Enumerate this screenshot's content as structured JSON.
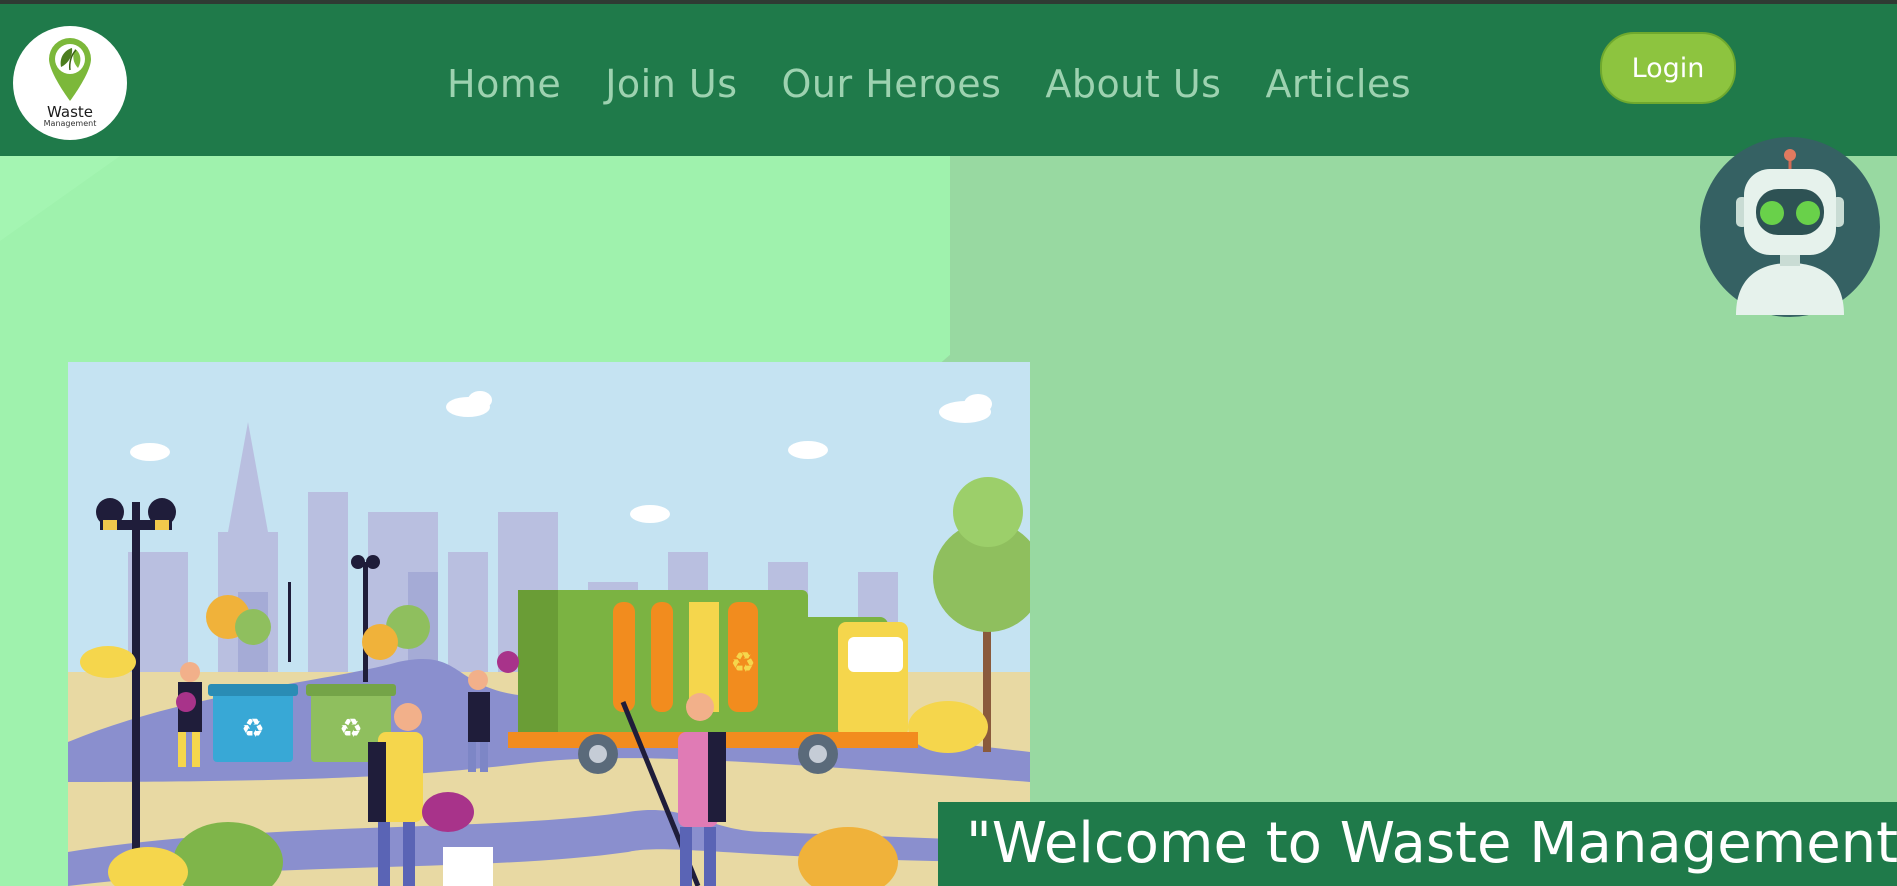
{
  "brand": {
    "logo_text": "Waste",
    "logo_sub": "Management",
    "colors": {
      "navbar": "#1f7a4a",
      "nav_link": "#9dd2b0",
      "login_bg": "#8dc43f",
      "hero_bg": "#98d9a1",
      "chatbot_bg": "#356163"
    }
  },
  "nav": {
    "links": [
      "Home",
      "Join Us",
      "Our Heroes",
      "About Us",
      "Articles"
    ],
    "login_label": "Login"
  },
  "chatbot": {
    "icon": "robot-icon"
  },
  "hero": {
    "illustration": "waste-collection-illustration",
    "welcome_text": "\"Welcome to Waste Management"
  }
}
